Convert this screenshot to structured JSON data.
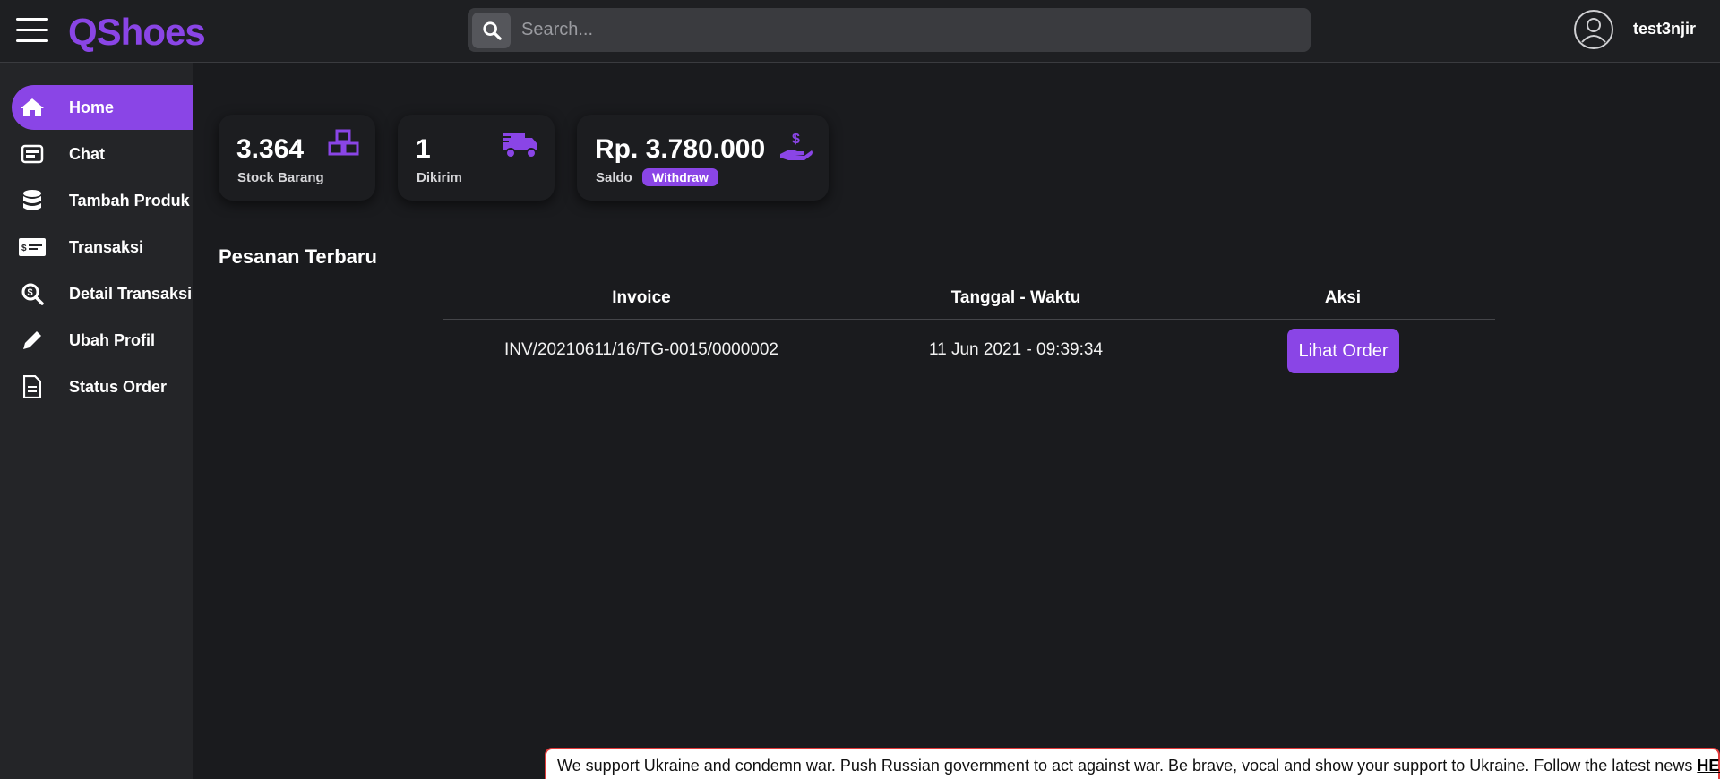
{
  "header": {
    "logo": "QShoes",
    "search_placeholder": "Search...",
    "username": "test3njir"
  },
  "sidebar": {
    "items": [
      {
        "label": "Home",
        "icon": "home-icon",
        "active": true
      },
      {
        "label": "Chat",
        "icon": "chat-icon"
      },
      {
        "label": "Tambah Produk",
        "icon": "database-icon"
      },
      {
        "label": "Transaksi",
        "icon": "money-bill-icon"
      },
      {
        "label": "Detail Transaksi",
        "icon": "search-dollar-icon"
      },
      {
        "label": "Ubah Profil",
        "icon": "pencil-icon"
      },
      {
        "label": "Status Order",
        "icon": "file-icon"
      }
    ]
  },
  "stats": {
    "stock": {
      "value": "3.364",
      "label": "Stock Barang",
      "icon": "cubes-icon"
    },
    "shipped": {
      "value": "1",
      "label": "Dikirim",
      "icon": "truck-icon"
    },
    "balance": {
      "value": "Rp. 3.780.000",
      "label": "Saldo",
      "action": "Withdraw",
      "icon": "hand-dollar-icon"
    }
  },
  "orders": {
    "title": "Pesanan Terbaru",
    "columns": [
      "Invoice",
      "Tanggal - Waktu",
      "Aksi"
    ],
    "rows": [
      {
        "invoice": "INV/20210611/16/TG-0015/0000002",
        "datetime": "11 Jun 2021 - 09:39:34",
        "action": "Lihat Order"
      }
    ]
  },
  "banner": {
    "text": "We support Ukraine and condemn war. Push Russian government to act against war. Be brave, vocal and show your support to Ukraine. Follow the latest news ",
    "link": "HERE"
  },
  "colors": {
    "accent": "#8a45e6",
    "background": "#1a1b1e",
    "sidebar": "#242528"
  }
}
